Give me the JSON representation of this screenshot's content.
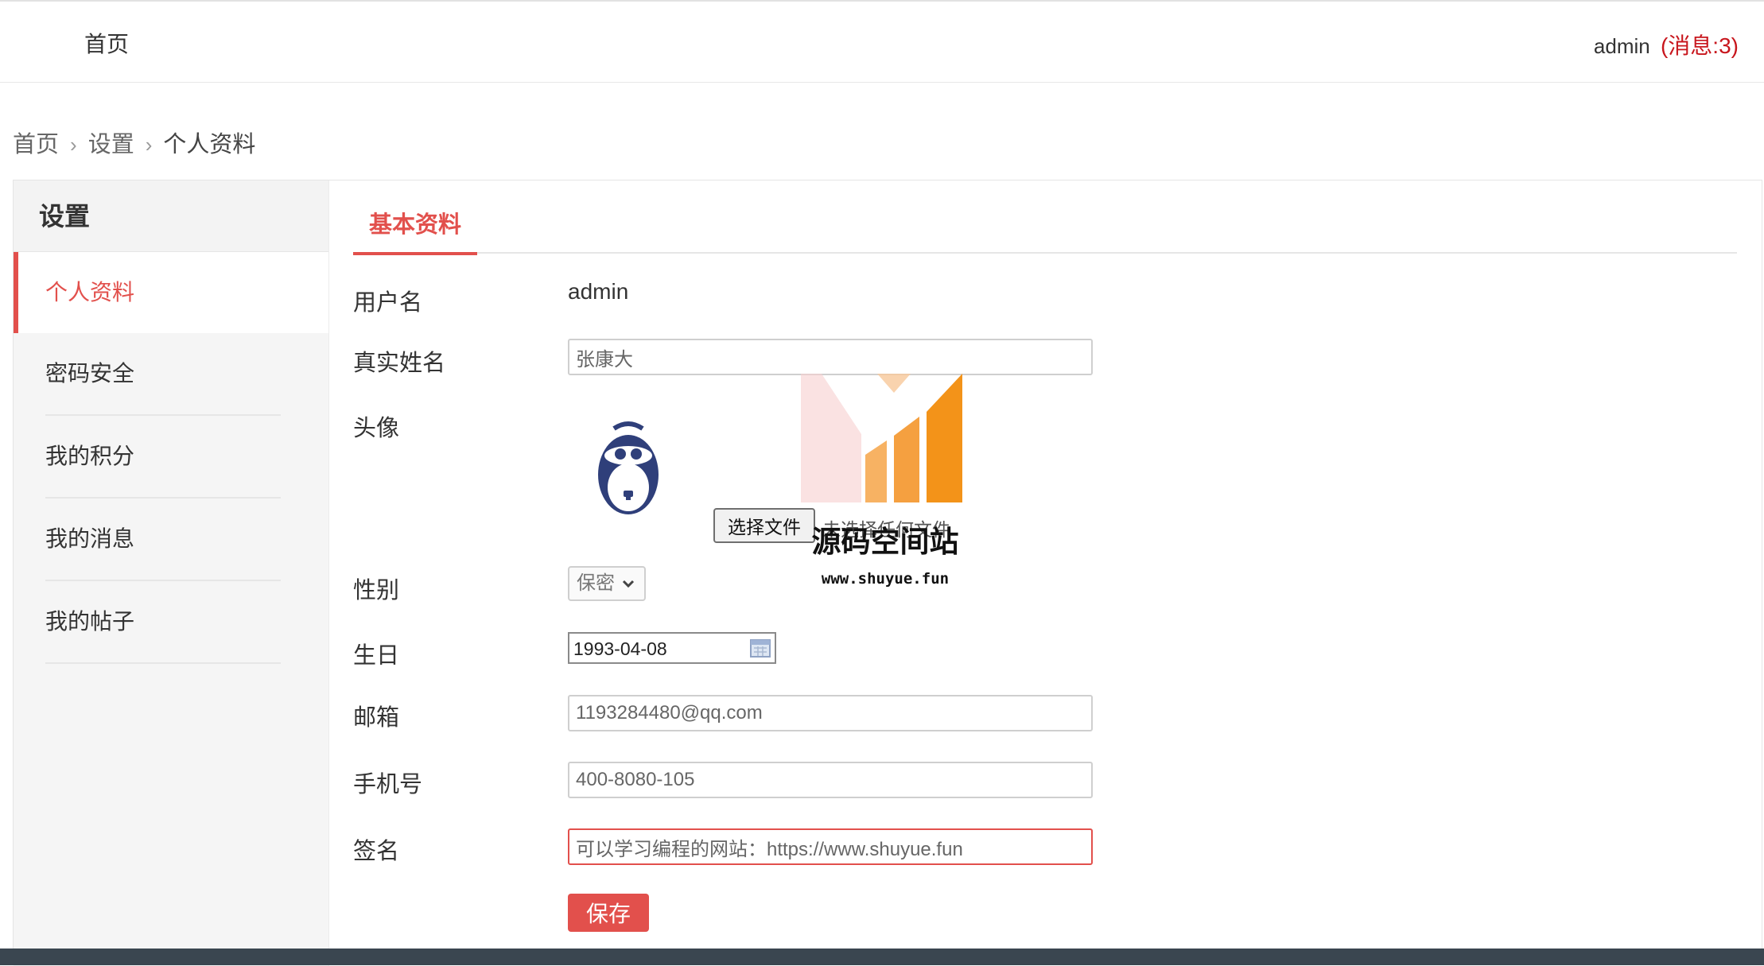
{
  "topbar": {
    "home": "首页",
    "user": "admin",
    "messages": "(消息:3)"
  },
  "breadcrumb": {
    "items": [
      "首页",
      "设置",
      "个人资料"
    ],
    "separator": "›"
  },
  "sidebar": {
    "title": "设置",
    "items": [
      {
        "label": "个人资料",
        "active": true
      },
      {
        "label": "密码安全"
      },
      {
        "label": "我的积分"
      },
      {
        "label": "我的消息"
      },
      {
        "label": "我的帖子"
      }
    ]
  },
  "tabs": {
    "basic": "基本资料"
  },
  "form": {
    "username": {
      "label": "用户名",
      "value": "admin"
    },
    "realname": {
      "label": "真实姓名",
      "value": "张康大"
    },
    "avatar": {
      "label": "头像",
      "button": "选择文件",
      "status": "未选择任何文件"
    },
    "gender": {
      "label": "性别",
      "selected": "保密"
    },
    "birthday": {
      "label": "生日",
      "value": "1993-04-08"
    },
    "email": {
      "label": "邮箱",
      "value": "1193284480@qq.com"
    },
    "phone": {
      "label": "手机号",
      "value": "400-8080-105"
    },
    "signature": {
      "label": "签名",
      "value": "可以学习编程的网站：https://www.shuyue.fun"
    },
    "save": "保存"
  },
  "watermark": {
    "title": "源码空间站",
    "url": "www.shuyue.fun"
  },
  "colors": {
    "accent": "#e2504c",
    "message": "#c8161d",
    "sidebar_bg": "#f5f5f5"
  },
  "icons": [
    "chevron-down-icon",
    "calendar-icon",
    "avatar-monkey-icon",
    "watermark-logo"
  ]
}
